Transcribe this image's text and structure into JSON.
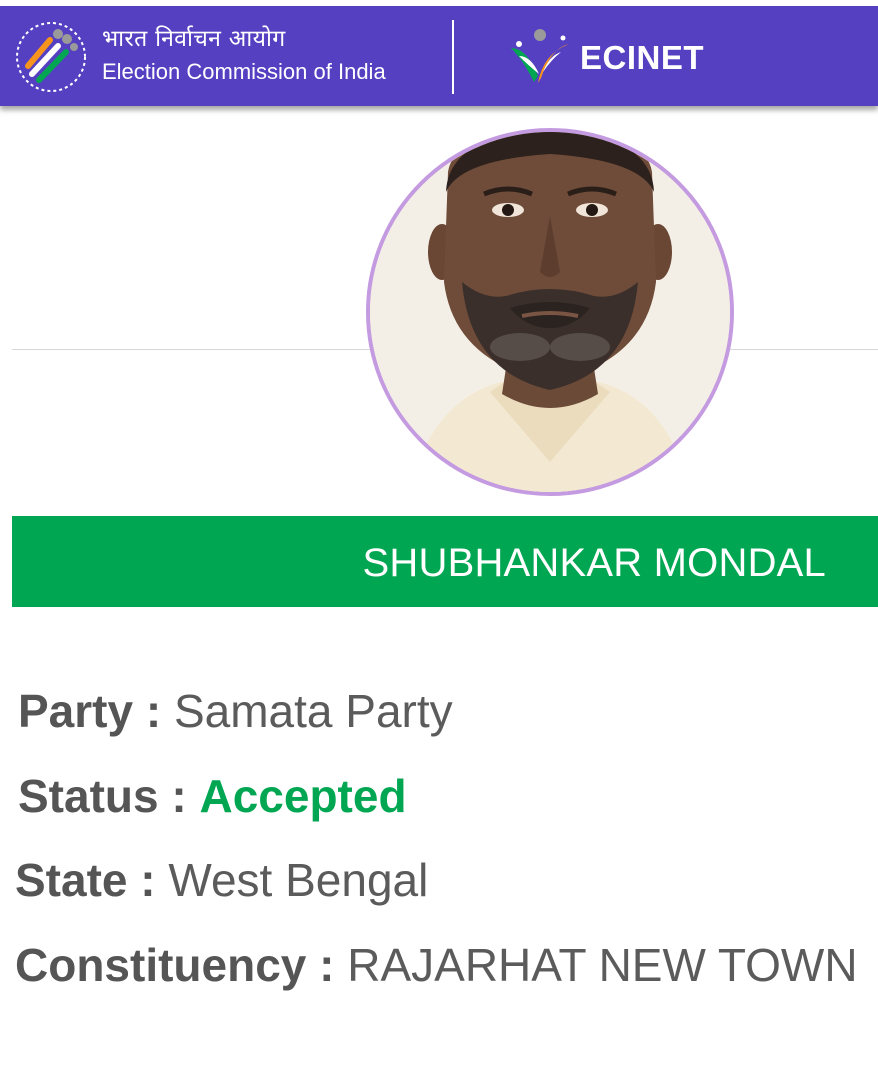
{
  "header": {
    "org_hindi": "भारत निर्वाचन आयोग",
    "org_english": "Election Commission of India",
    "app_name": "ECINET"
  },
  "candidate": {
    "name": "SHUBHANKAR MONDAL",
    "photo": "candidate-portrait"
  },
  "details": {
    "party_label": "Party :",
    "party_value": "Samata Party",
    "status_label": "Status :",
    "status_value": "Accepted",
    "state_label": "State :",
    "state_value": "West Bengal",
    "constituency_label": "Constituency :",
    "constituency_value": "RAJARHAT NEW TOWN"
  },
  "colors": {
    "header_bg": "#5540c2",
    "name_bar": "#00a651",
    "accepted": "#00a651",
    "photo_border": "#c49be0"
  }
}
